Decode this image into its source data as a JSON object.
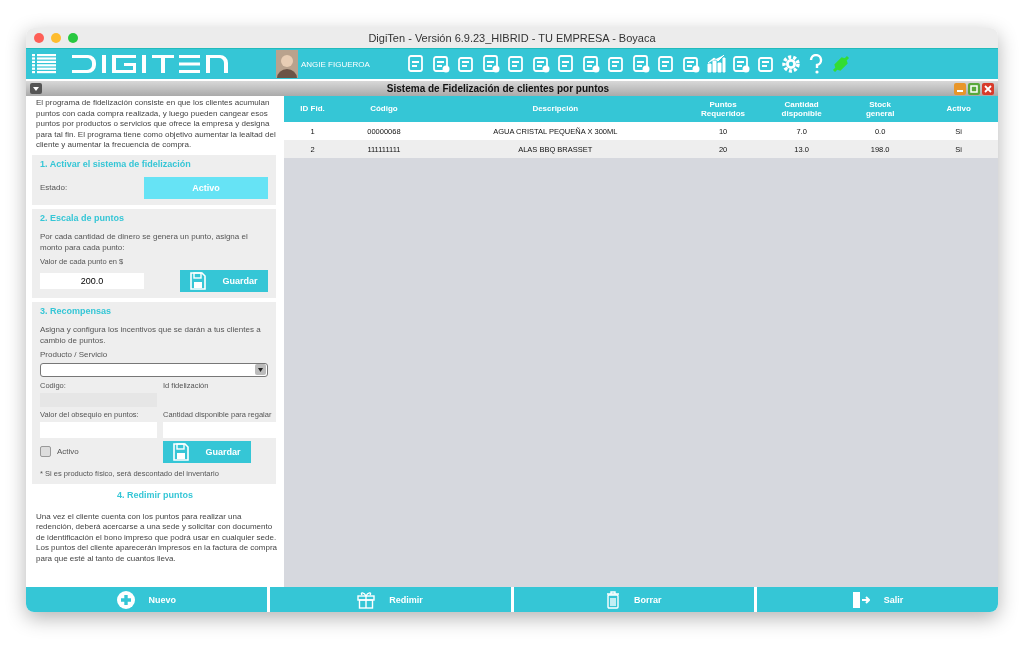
{
  "window": {
    "title": "DigiTen - Versión 6.9.23_HIBRID  -  TU EMPRESA - Boyaca"
  },
  "header": {
    "user": "ANGIE FIGUEROA"
  },
  "panel_title": "Sistema  de Fidelización de clientes por puntos",
  "intro": "El programa de fidelización consiste en que los clientes acumulan puntos con cada compra realizada, y luego pueden cangear esos puntos por productos o servicios que ofrece la empresa y designa\npara tal fin. El programa tiene como objetivo aumentar la lealtad del cliente y aumentar la frecuencia de compra.",
  "activate": {
    "heading": "1. Activar el sistema de fidelización",
    "label": "Estado:",
    "toggle": {
      "label": "Activo",
      "on": true
    }
  },
  "scale": {
    "heading": "2. Escala de puntos",
    "text": "Por cada cantidad de dinero se genera un punto, asigna el monto para cada punto:",
    "field_label": "Valor de cada punto en $",
    "value": "200.0",
    "button": "Guardar"
  },
  "rewards": {
    "heading": "3. Recompensas",
    "text": "Asigna y configura los incentivos que se darán a tus clientes a cambio de puntos.",
    "product_label": "Producto / Servicio",
    "code_label": "Codigo:",
    "id_label": "Id fidelización",
    "points_label": "Valor del obsequio en puntos:",
    "qty_label": "Cantidad disponible para regalar",
    "checkbox": {
      "label": "Activo",
      "checked": false
    },
    "button": "Guardar",
    "note": "* Si es producto físico, será descontado del inventario"
  },
  "redeem": {
    "heading": "4. Redimir puntos",
    "text": "Una vez el cliente cuenta con los puntos para realizar una redención, deberá acercarse a una sede y solicitar con documento de identificación el bono impreso que podrá usar en cualquier sede. Los puntos del cliente aparecerán impresos en la factura de compra para que esté al tanto de cuantos lleva."
  },
  "table": {
    "columns": [
      "ID Fid.",
      "Código",
      "Descripción",
      "Puntos\nRequeridos",
      "Cantidad\ndisponible",
      "Stock\ngeneral",
      "Activo"
    ],
    "rows": [
      [
        "1",
        "00000068",
        "AGUA CRISTAL PEQUEÑA X 300ML",
        "10",
        "7.0",
        "0.0",
        "Si"
      ],
      [
        "2",
        "111111111",
        "ALAS BBQ BRASSET",
        "20",
        "13.0",
        "198.0",
        "Si"
      ]
    ]
  },
  "actions": [
    {
      "kind": "add",
      "label": "Nuevo"
    },
    {
      "kind": "gift",
      "label": "Redimir"
    },
    {
      "kind": "trash",
      "label": "Borrar"
    },
    {
      "kind": "exit",
      "label": "Salir"
    }
  ]
}
